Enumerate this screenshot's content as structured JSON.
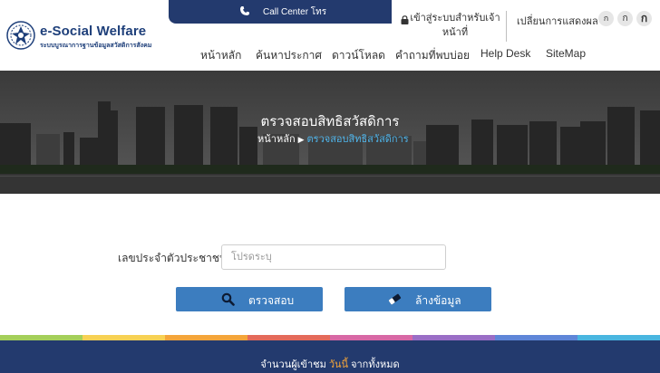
{
  "brand": {
    "title": "e-Social Welfare",
    "subtitle": "ระบบบูรณาการฐานข้อมูลสวัสดิการสังคม",
    "color": "#1e3f7a"
  },
  "topbar": {
    "call_center": "Call Center โทร",
    "color": "#233a6e"
  },
  "login": {
    "label": "เข้าสู่ระบบสำหรับเจ้าหน้าที่"
  },
  "display": {
    "label": "เปลี่ยนการแสดงผล",
    "font_sizes": [
      "ก",
      "ก",
      "ก"
    ]
  },
  "nav": {
    "items": [
      "หน้าหลัก",
      "ค้นหาประกาศ",
      "ดาวน์โหลด",
      "คำถามที่พบบ่อย",
      "Help Desk",
      "SiteMap"
    ]
  },
  "banner": {
    "title": "ตรวจสอบสิทธิสวัสดิการ",
    "breadcrumb_home": "หน้าหลัก",
    "breadcrumb_current": "ตรวจสอบสิทธิสวัสดิการ"
  },
  "form": {
    "id_label": "เลขประจำตัวประชาชน",
    "id_value": "",
    "id_placeholder": "โปรดระบุ",
    "check_label": "ตรวจสอบ",
    "clear_label": "ล้างข้อมูล",
    "button_color": "#3c7dbf"
  },
  "footer": {
    "visitors_prefix": "จำนวนผู้เข้าชม",
    "visitors_today": "วันนี้",
    "visitors_suffix": "จากทั้งหมด",
    "stripe_colors": [
      "#a4cf5a",
      "#f7d154",
      "#f4a53a",
      "#e46a5a",
      "#d868a5",
      "#9a6ec6",
      "#5f86d8",
      "#49b6e0"
    ]
  }
}
